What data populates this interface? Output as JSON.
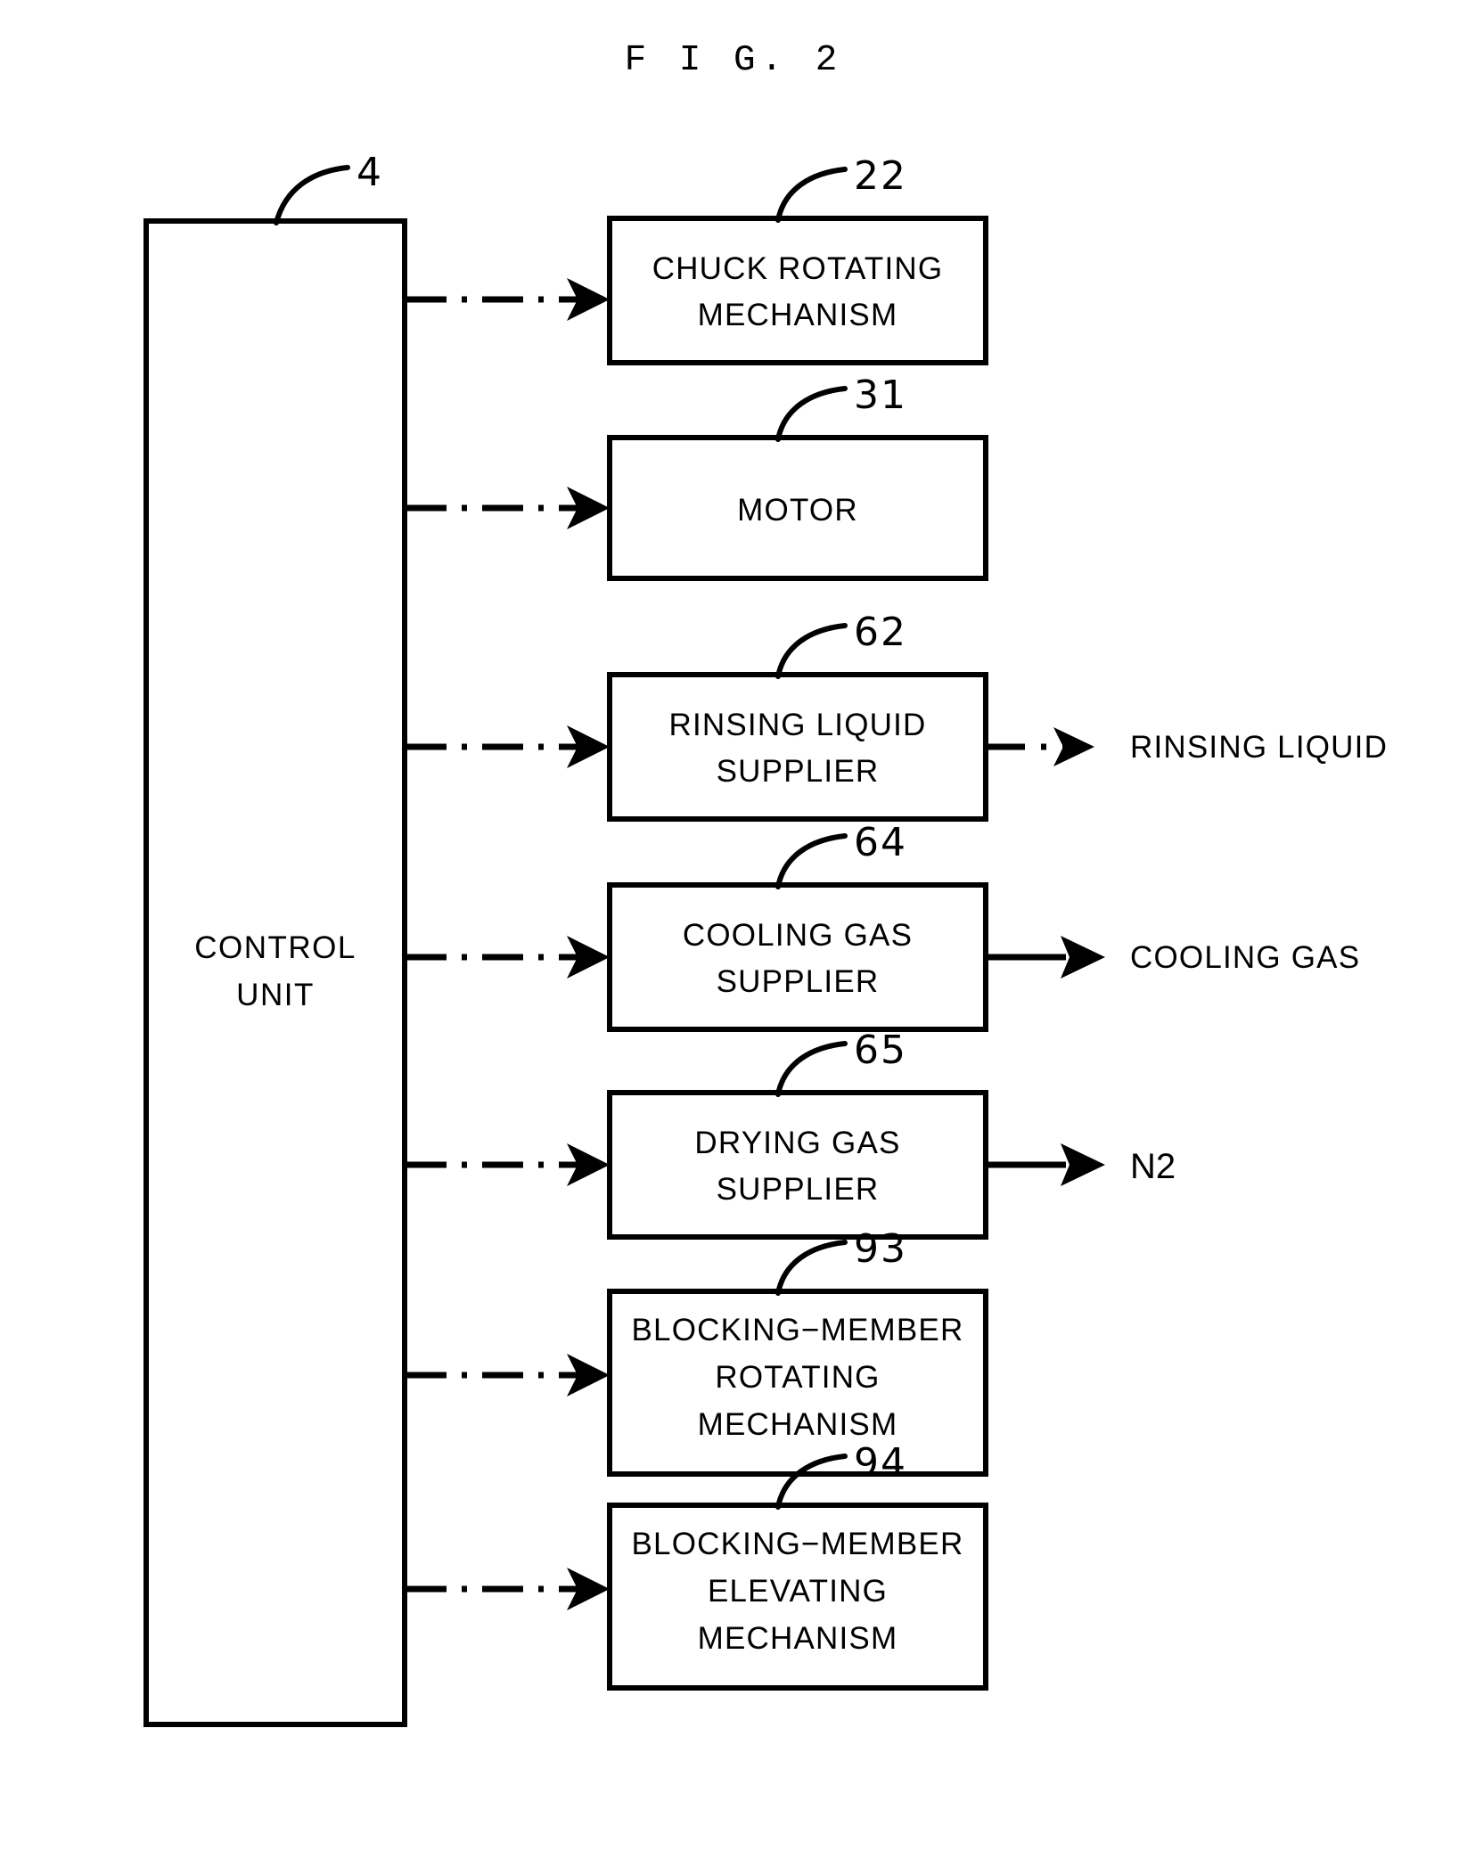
{
  "figure": {
    "title": "F I G.  2",
    "controller": {
      "ref": "4",
      "label_line1": "CONTROL",
      "label_line2": "UNIT"
    },
    "blocks": [
      {
        "ref": "22",
        "lines": [
          "CHUCK ROTATING",
          "MECHANISM"
        ],
        "name": "chuck-rotating-mechanism",
        "output": null
      },
      {
        "ref": "31",
        "lines": [
          "MOTOR"
        ],
        "name": "motor",
        "output": null
      },
      {
        "ref": "62",
        "lines": [
          "RINSING LIQUID",
          "SUPPLIER"
        ],
        "name": "rinsing-liquid-supplier",
        "output": {
          "label": "RINSING LIQUID",
          "style": "dotted"
        }
      },
      {
        "ref": "64",
        "lines": [
          "COOLING GAS",
          "SUPPLIER"
        ],
        "name": "cooling-gas-supplier",
        "output": {
          "label": "COOLING GAS",
          "style": "solid"
        }
      },
      {
        "ref": "65",
        "lines": [
          "DRYING GAS",
          "SUPPLIER"
        ],
        "name": "drying-gas-supplier",
        "output": {
          "label": "N2",
          "style": "solid"
        }
      },
      {
        "ref": "93",
        "lines": [
          "BLOCKING−MEMBER",
          "ROTATING",
          "MECHANISM"
        ],
        "name": "blocking-member-rotating-mechanism",
        "output": null
      },
      {
        "ref": "94",
        "lines": [
          "BLOCKING−MEMBER",
          "ELEVATING",
          "MECHANISM"
        ],
        "name": "blocking-member-elevating-mechanism",
        "output": null
      }
    ],
    "connector_style": "dash-dot-arrow",
    "colors": {
      "ink": "#000000",
      "background": "#ffffff"
    }
  }
}
